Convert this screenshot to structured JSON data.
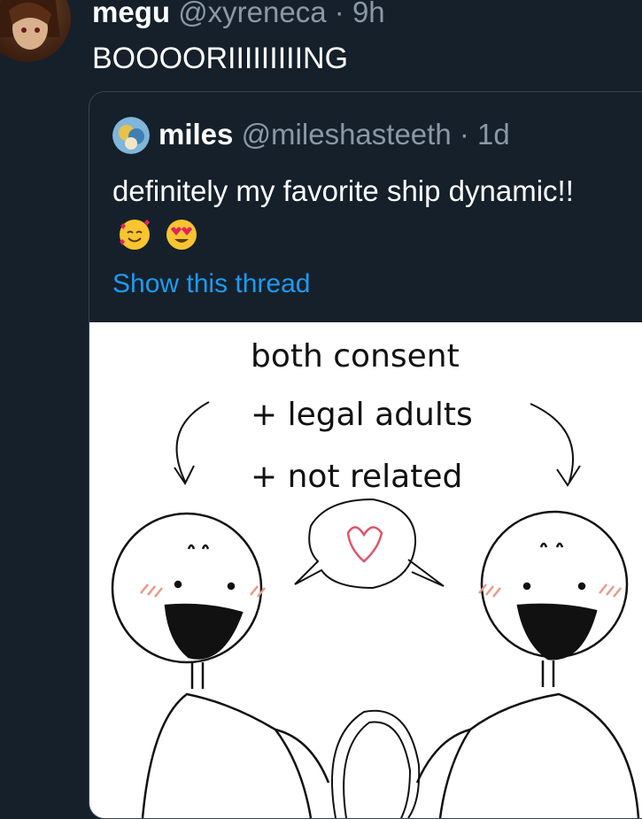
{
  "tweet": {
    "display_name": "megu",
    "handle": "@xyreneca",
    "separator": "·",
    "time": "9h",
    "text": "BOOOORIIIIIIIIING"
  },
  "quote": {
    "display_name": "miles",
    "handle": "@mileshasteeth",
    "separator": "·",
    "time": "1d",
    "text": "definitely my favorite ship dynamic!!",
    "emojis": [
      "smiling-face-with-hearts-emoji",
      "heart-eyes-emoji"
    ],
    "show_thread": "Show this thread"
  },
  "comic": {
    "line1": "both consent",
    "line2": "+ legal adults",
    "line3": "+ not related"
  },
  "colors": {
    "background": "#15202b",
    "border": "#38444d",
    "secondary_text": "#8b98a5",
    "link": "#1d9bf0"
  }
}
